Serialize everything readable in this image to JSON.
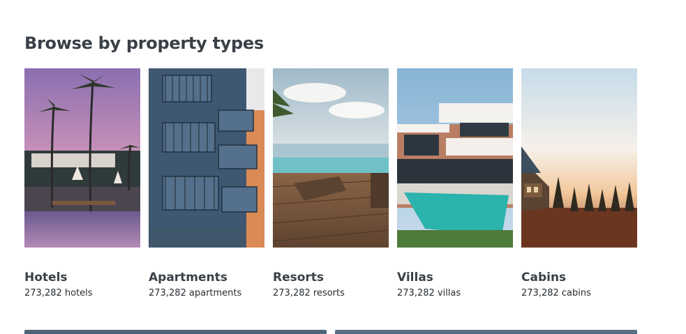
{
  "section": {
    "title": "Browse by property types"
  },
  "property_types": [
    {
      "name": "Hotels",
      "count": "273,282 hotels",
      "image": "hotel-pool-palms-image"
    },
    {
      "name": "Apartments",
      "count": "273,282 apartments",
      "image": "apartment-balconies-image"
    },
    {
      "name": "Resorts",
      "count": "273,282 resorts",
      "image": "resort-deck-sea-image"
    },
    {
      "name": "Villas",
      "count": "273,282 villas",
      "image": "modern-villa-pool-image"
    },
    {
      "name": "Cabins",
      "count": "273,282 cabins",
      "image": "cabin-forest-sunset-image"
    }
  ],
  "colors": {
    "title": "#3a4048",
    "text": "#262b30",
    "carousel_bar": "#4f6577"
  }
}
